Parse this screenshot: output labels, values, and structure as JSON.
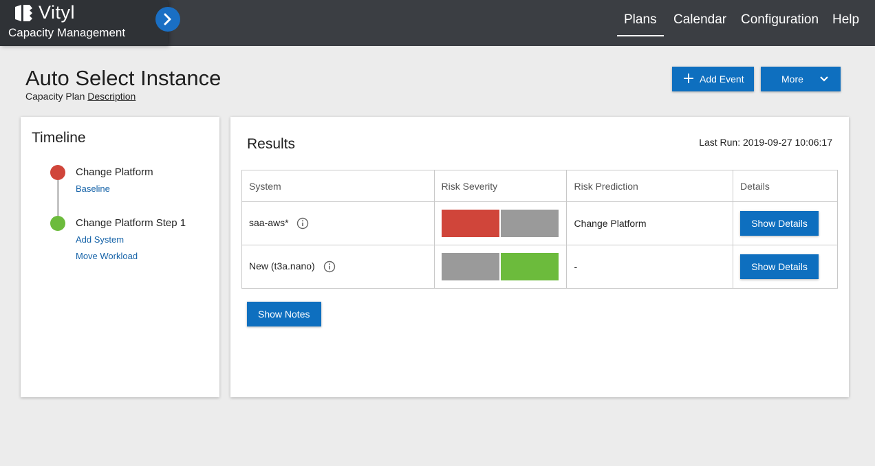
{
  "app": {
    "brand_name": "Vityl",
    "brand_sub": "Capacity Management"
  },
  "nav": {
    "items": [
      {
        "label": "Plans",
        "active": true
      },
      {
        "label": "Calendar",
        "active": false
      },
      {
        "label": "Configuration",
        "active": false
      },
      {
        "label": "Help",
        "active": false
      }
    ]
  },
  "page": {
    "title": "Auto Select Instance",
    "subtitle_prefix": "Capacity Plan",
    "subtitle_link": "Description",
    "add_event_label": "Add Event",
    "more_label": "More"
  },
  "timeline": {
    "title": "Timeline",
    "steps": [
      {
        "label": "Change Platform",
        "status_color": "#d0453a",
        "links": [
          "Baseline"
        ]
      },
      {
        "label": "Change Platform Step 1",
        "status_color": "#6cbb3c",
        "links": [
          "Add System",
          "Move Workload"
        ]
      }
    ]
  },
  "results": {
    "title": "Results",
    "last_run": "Last Run: 2019-09-27 10:06:17",
    "columns": [
      "System",
      "Risk Severity",
      "Risk Prediction",
      "Details"
    ],
    "rows": [
      {
        "system": "saa-aws*",
        "severity_colors": [
          "#d0453a",
          "#9a9a9a"
        ],
        "prediction": "Change Platform",
        "details_label": "Show Details"
      },
      {
        "system": "New (t3a.nano)",
        "severity_colors": [
          "#9a9a9a",
          "#6cbb3c"
        ],
        "prediction": "-",
        "details_label": "Show Details"
      }
    ],
    "show_notes_label": "Show Notes"
  },
  "icons": {
    "logo": "vityl-logo-icon",
    "expand": "chevron-right-icon",
    "add": "plus-icon",
    "more": "chevron-down-icon",
    "info": "info-icon"
  },
  "colors": {
    "accent": "#0e6fbf",
    "header": "#3b3e43",
    "risk_high": "#d0453a",
    "risk_ok": "#6cbb3c",
    "risk_neutral": "#9a9a9a"
  }
}
